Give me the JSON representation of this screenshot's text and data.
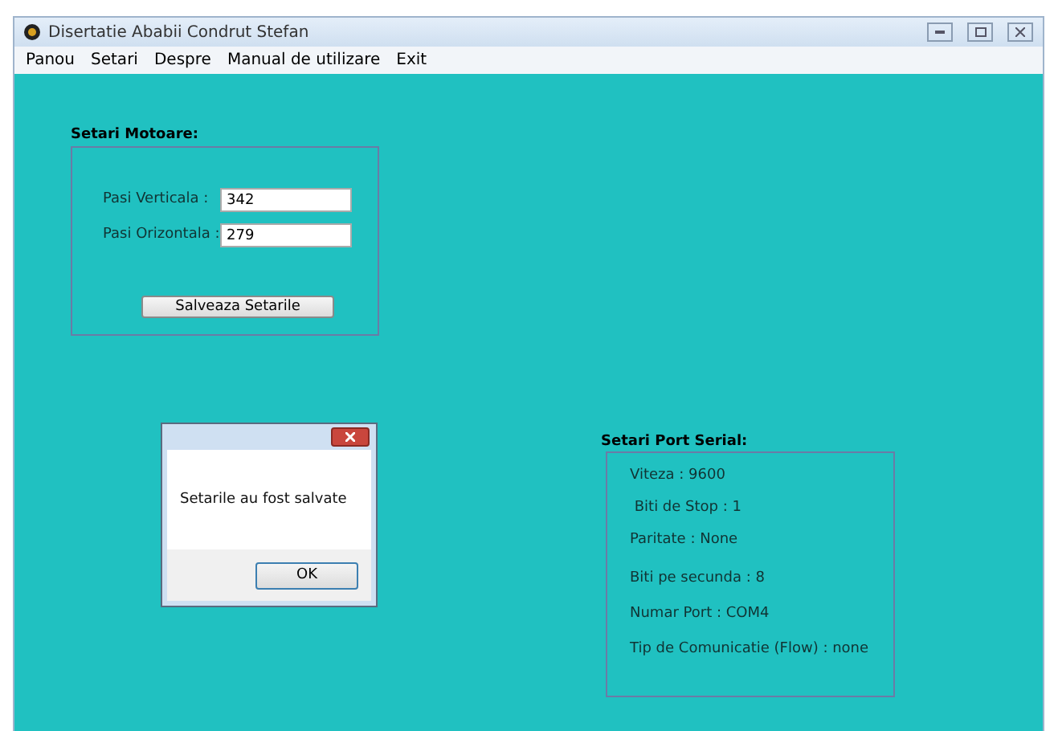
{
  "window": {
    "title": "Disertatie Ababii Condrut Stefan"
  },
  "menu": [
    "Panou",
    "Setari",
    "Despre",
    "Manual de utilizare",
    "Exit"
  ],
  "motor_settings": {
    "title": "Setari Motoare:",
    "fields": [
      {
        "label": "Pasi Verticala :",
        "value": "342"
      },
      {
        "label": "Pasi Orizontala :",
        "value": "279"
      }
    ],
    "button": "Salveaza Setarile"
  },
  "serial_settings": {
    "title": "Setari Port Serial:",
    "lines": [
      "Viteza : 9600",
      " Biti de Stop : 1",
      "Paritate : None",
      "Biti pe secunda : 8",
      "Numar Port : COM4",
      "Tip de Comunicatie (Flow) : none"
    ]
  },
  "dialog": {
    "message": "Setarile au fost salvate",
    "button": "OK"
  }
}
